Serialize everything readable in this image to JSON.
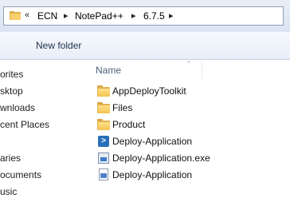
{
  "address_bar": {
    "overflow_glyph": "«",
    "separator_glyph": "▸",
    "crumbs": [
      "ECN",
      "NotePad++",
      "6.7.5"
    ]
  },
  "toolbar": {
    "new_folder_label": "New folder"
  },
  "navigation": {
    "items": [
      "orites",
      "sktop",
      "wnloads",
      "cent Places",
      "aries",
      "ocuments",
      "usic"
    ]
  },
  "file_list": {
    "column_name": "Name",
    "sort_glyph": "^",
    "items": [
      {
        "name": "AppDeployToolkit",
        "icon": "folder-icon"
      },
      {
        "name": "Files",
        "icon": "folder-icon"
      },
      {
        "name": "Product",
        "icon": "folder-icon"
      },
      {
        "name": "Deploy-Application",
        "icon": "powershell-script-icon"
      },
      {
        "name": "Deploy-Application.exe",
        "icon": "application-exe-icon"
      },
      {
        "name": "Deploy-Application",
        "icon": "config-file-icon"
      }
    ]
  }
}
